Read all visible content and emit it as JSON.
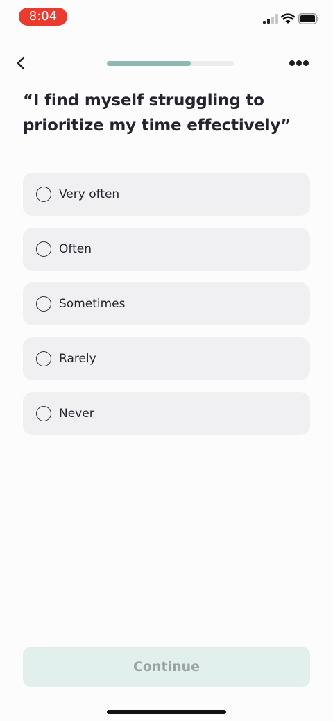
{
  "status_bar": {
    "time": "8:04",
    "icons": [
      "signal-icon",
      "wifi-icon",
      "battery-icon"
    ]
  },
  "nav": {
    "back_icon": "chevron-left-icon",
    "more_icon": "ellipsis-icon",
    "progress_fraction": 0.66
  },
  "question": {
    "text": "“I find myself struggling to prioritize my time effectively”"
  },
  "options": [
    {
      "label": "Very often",
      "selected": false
    },
    {
      "label": "Often",
      "selected": false
    },
    {
      "label": "Sometimes",
      "selected": false
    },
    {
      "label": "Rarely",
      "selected": false
    },
    {
      "label": "Never",
      "selected": false
    }
  ],
  "continue_label": "Continue",
  "colors": {
    "accent": "#8fb8b2",
    "continue_bg": "#e1efed",
    "option_bg": "#f0eff1",
    "time_pill": "#ea3b2e"
  }
}
